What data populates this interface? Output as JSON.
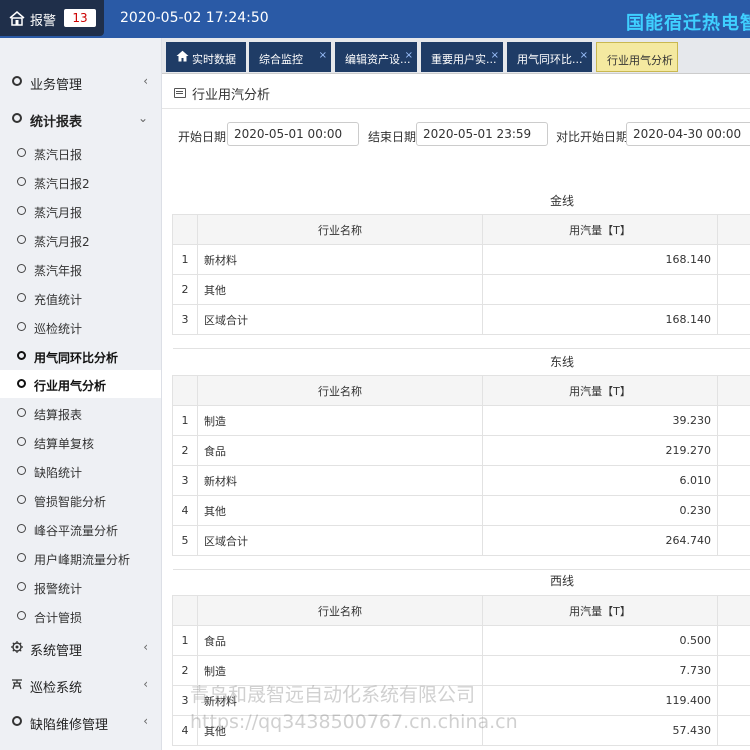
{
  "header": {
    "alarm_label": "报警",
    "alarm_count": "13",
    "datetime": "2020-05-02 17:24:50",
    "brand": "国能宿迁热电智"
  },
  "sidebar": {
    "groups": [
      {
        "label": "业务管理",
        "chevron": "‹"
      },
      {
        "label": "统计报表",
        "chevron": "⌄"
      },
      {
        "label": "系统管理",
        "chevron": "‹"
      },
      {
        "label": "巡检系统",
        "chevron": "‹"
      },
      {
        "label": "缺陷维修管理",
        "chevron": "‹"
      }
    ],
    "items": [
      "蒸汽日报",
      "蒸汽日报2",
      "蒸汽月报",
      "蒸汽月报2",
      "蒸汽年报",
      "充值统计",
      "巡检统计",
      "用气同环比分析",
      "行业用气分析",
      "结算报表",
      "结算单复核",
      "缺陷统计",
      "管损智能分析",
      "峰谷平流量分析",
      "用户峰期流量分析",
      "报警统计",
      "合计管损"
    ]
  },
  "tabs": [
    {
      "label": "实时数据"
    },
    {
      "label": "综合监控",
      "close": "×"
    },
    {
      "label": "编辑资产设...",
      "close": "×"
    },
    {
      "label": "重要用户实...",
      "close": "×"
    },
    {
      "label": "用气同环比...",
      "close": "×"
    },
    {
      "label": "行业用气分析"
    }
  ],
  "page": {
    "title": "行业用汽分析",
    "filters": {
      "start_label": "开始日期:",
      "start_value": "2020-05-01 00:00",
      "end_label": "结束日期:",
      "end_value": "2020-05-01 23:59",
      "cmp_label": "对比开始日期:",
      "cmp_value": "2020-04-30 00:00"
    }
  },
  "tables": [
    {
      "title": "金线",
      "headers": [
        "行业名称",
        "用汽量【T】"
      ],
      "rows": [
        [
          "1",
          "新材料",
          "168.140"
        ],
        [
          "2",
          "其他",
          ""
        ],
        [
          "3",
          "区域合计",
          "168.140"
        ]
      ]
    },
    {
      "title": "东线",
      "headers": [
        "行业名称",
        "用汽量【T】"
      ],
      "rows": [
        [
          "1",
          "制造",
          "39.230"
        ],
        [
          "2",
          "食品",
          "219.270"
        ],
        [
          "3",
          "新材料",
          "6.010"
        ],
        [
          "4",
          "其他",
          "0.230"
        ],
        [
          "5",
          "区域合计",
          "264.740"
        ]
      ]
    },
    {
      "title": "西线",
      "headers": [
        "行业名称",
        "用汽量【T】"
      ],
      "rows": [
        [
          "1",
          "食品",
          "0.500"
        ],
        [
          "2",
          "制造",
          "7.730"
        ],
        [
          "3",
          "新材料",
          "119.400"
        ],
        [
          "4",
          "其他",
          "57.430"
        ]
      ]
    }
  ],
  "watermark": {
    "line1": "青岛和晟智远自动化系统有限公司",
    "line2": "https://qq3438500767.cn.china.cn"
  },
  "colors": {
    "header_bg": "#2a5aa6",
    "tab_bg": "#1f3c66",
    "tab_active_bg": "#f4e9a0",
    "brand": "#3fd0ff",
    "alarm_count": "#cc0000"
  }
}
